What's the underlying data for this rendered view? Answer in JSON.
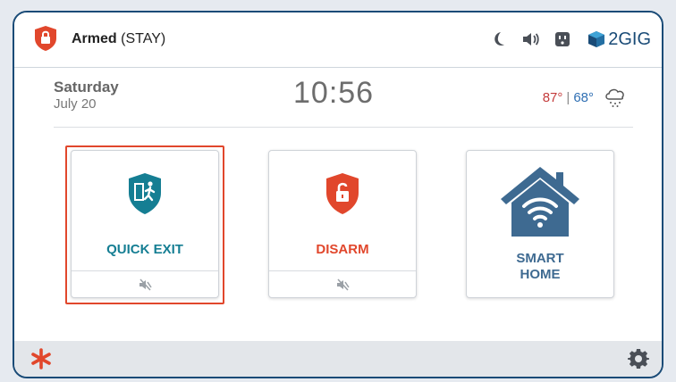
{
  "status": {
    "state": "Armed",
    "mode": "(STAY)"
  },
  "brand": {
    "name": "2GIG"
  },
  "topbar_icons": [
    "moon-icon",
    "speaker-icon",
    "outlet-icon",
    "brand-logo-icon"
  ],
  "date_info": {
    "day": "Saturday",
    "date": "July 20",
    "time": "10:56"
  },
  "weather": {
    "high": "87°",
    "separator": "|",
    "low": "68°",
    "icon": "snow-cloud-icon"
  },
  "tiles": [
    {
      "label": "QUICK EXIT",
      "icon": "quick-exit-shield-icon",
      "color": "#157e93",
      "muted_icon": "mute-icon",
      "selected": true
    },
    {
      "label": "DISARM",
      "icon": "disarm-shield-icon",
      "color": "#e1472c",
      "muted_icon": "mute-icon",
      "selected": false
    },
    {
      "label": "SMART",
      "label2": "HOME",
      "icon": "smart-home-icon",
      "color": "#3e6a91",
      "selected": false
    }
  ],
  "colors": {
    "accent_red": "#e1472c",
    "teal": "#157e93",
    "navy": "#1a4b77",
    "smart_home": "#3e6a91"
  }
}
